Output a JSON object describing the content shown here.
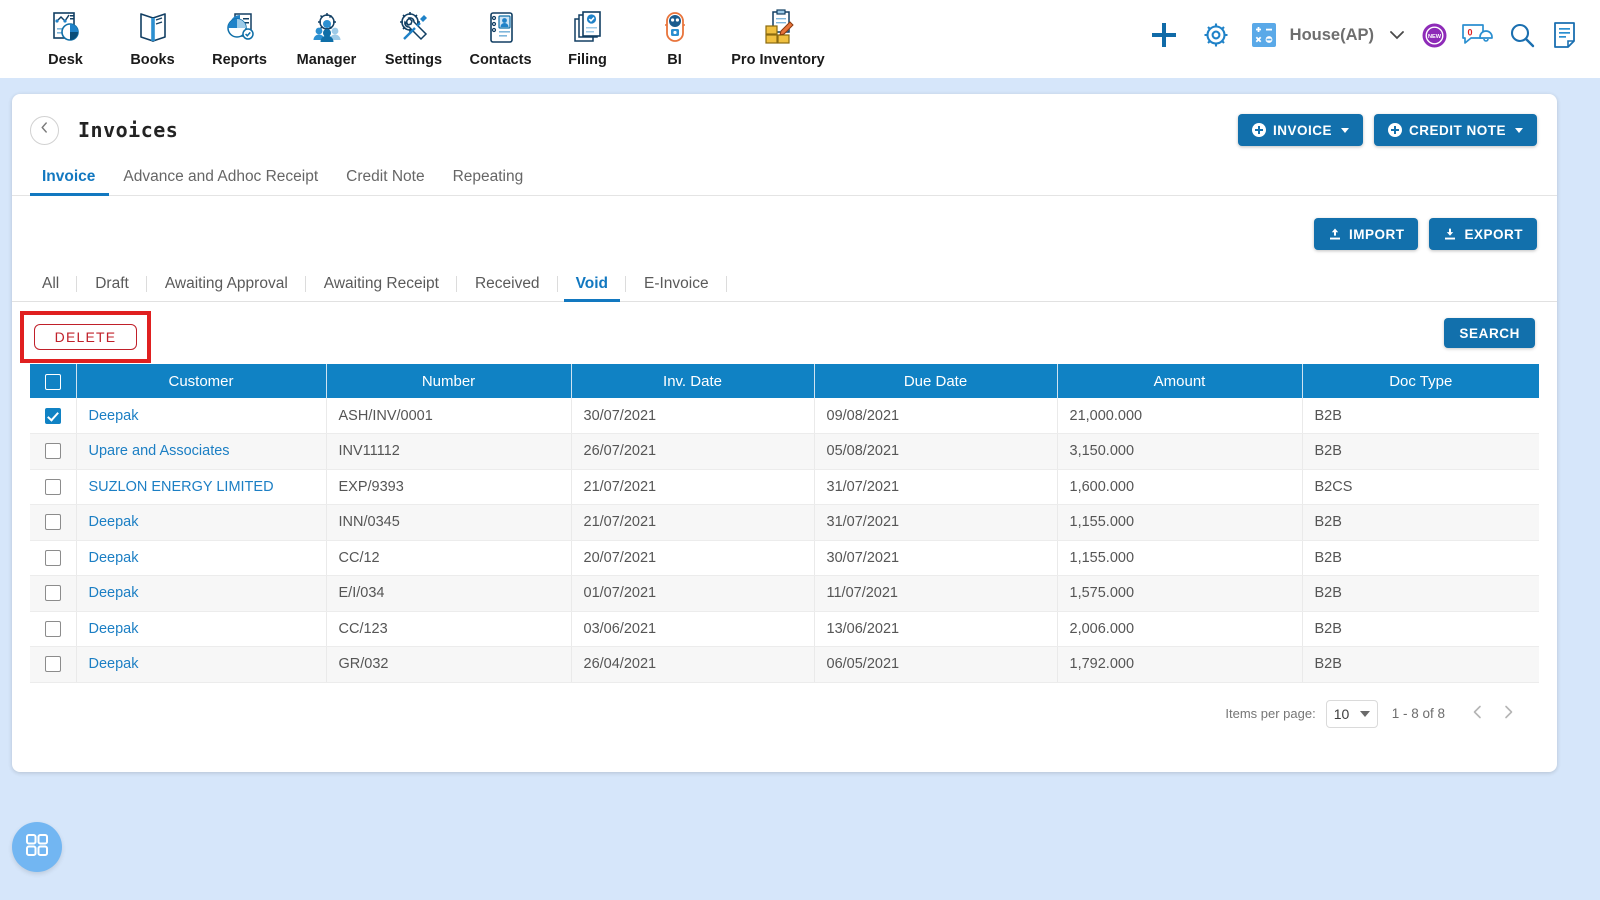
{
  "topnav": {
    "items": [
      {
        "label": "Desk",
        "icon": "dashboard-icon"
      },
      {
        "label": "Books",
        "icon": "book-icon"
      },
      {
        "label": "Reports",
        "icon": "reports-chart-icon"
      },
      {
        "label": "Manager",
        "icon": "manager-gear-people-icon"
      },
      {
        "label": "Settings",
        "icon": "settings-tools-icon"
      },
      {
        "label": "Contacts",
        "icon": "contacts-card-icon"
      },
      {
        "label": "Filing",
        "icon": "filing-documents-icon"
      },
      {
        "label": "BI",
        "icon": "bi-robot-icon"
      },
      {
        "label": "Pro Inventory",
        "icon": "pro-inventory-boxes-icon"
      }
    ],
    "right": {
      "add_icon": "plus-icon",
      "settings_icon": "gear-icon",
      "calculator_icon": "calculator-icon",
      "org_name": "House(AP)",
      "org_caret_icon": "chevron-down-icon",
      "new_badge_icon": "new-badge-icon",
      "new_badge_text": "NEW",
      "notifications_icon": "chat-bell-icon",
      "notifications_count": "0",
      "search_icon": "search-icon",
      "notes_icon": "notepad-icon"
    }
  },
  "page": {
    "back_icon": "chevron-left-icon",
    "title": "Invoices",
    "primary_actions": [
      {
        "label": "INVOICE",
        "icon": "plus-circle-icon",
        "caret": "caret-down-icon"
      },
      {
        "label": "CREDIT NOTE",
        "icon": "plus-circle-icon",
        "caret": "caret-down-icon"
      }
    ],
    "tabs": [
      {
        "label": "Invoice",
        "active": true
      },
      {
        "label": "Advance and Adhoc Receipt",
        "active": false
      },
      {
        "label": "Credit Note",
        "active": false
      },
      {
        "label": "Repeating",
        "active": false
      }
    ],
    "io_buttons": [
      {
        "label": "IMPORT",
        "icon": "upload-icon"
      },
      {
        "label": "EXPORT",
        "icon": "download-icon"
      }
    ],
    "status_filters": [
      {
        "label": "All",
        "active": false
      },
      {
        "label": "Draft",
        "active": false
      },
      {
        "label": "Awaiting Approval",
        "active": false
      },
      {
        "label": "Awaiting Receipt",
        "active": false
      },
      {
        "label": "Received",
        "active": false
      },
      {
        "label": "Void",
        "active": true
      },
      {
        "label": "E-Invoice",
        "active": false
      }
    ],
    "delete_label": "DELETE",
    "search_label": "SEARCH",
    "highlight_color": "#e02020",
    "accent_color": "#1082c4"
  },
  "table": {
    "columns": [
      "",
      "Customer",
      "Number",
      "Inv. Date",
      "Due Date",
      "Amount",
      "Doc Type"
    ],
    "header_select_all_checked": false,
    "rows": [
      {
        "selected": true,
        "customer": "Deepak",
        "number": "ASH/INV/0001",
        "inv_date": "30/07/2021",
        "due_date": "09/08/2021",
        "amount": "21,000.000",
        "doc_type": "B2B"
      },
      {
        "selected": false,
        "customer": "Upare and Associates",
        "number": "INV11112",
        "inv_date": "26/07/2021",
        "due_date": "05/08/2021",
        "amount": "3,150.000",
        "doc_type": "B2B"
      },
      {
        "selected": false,
        "customer": "SUZLON ENERGY LIMITED",
        "number": "EXP/9393",
        "inv_date": "21/07/2021",
        "due_date": "31/07/2021",
        "amount": "1,600.000",
        "doc_type": "B2CS"
      },
      {
        "selected": false,
        "customer": "Deepak",
        "number": "INN/0345",
        "inv_date": "21/07/2021",
        "due_date": "31/07/2021",
        "amount": "1,155.000",
        "doc_type": "B2B"
      },
      {
        "selected": false,
        "customer": "Deepak",
        "number": "CC/12",
        "inv_date": "20/07/2021",
        "due_date": "30/07/2021",
        "amount": "1,155.000",
        "doc_type": "B2B"
      },
      {
        "selected": false,
        "customer": "Deepak",
        "number": "E/I/034",
        "inv_date": "01/07/2021",
        "due_date": "11/07/2021",
        "amount": "1,575.000",
        "doc_type": "B2B"
      },
      {
        "selected": false,
        "customer": "Deepak",
        "number": "CC/123",
        "inv_date": "03/06/2021",
        "due_date": "13/06/2021",
        "amount": "2,006.000",
        "doc_type": "B2B"
      },
      {
        "selected": false,
        "customer": "Deepak",
        "number": "GR/032",
        "inv_date": "26/04/2021",
        "due_date": "06/05/2021",
        "amount": "1,792.000",
        "doc_type": "B2B"
      }
    ]
  },
  "paginator": {
    "items_per_page_label": "Items per page:",
    "items_per_page_value": "10",
    "range_label": "1 - 8 of 8",
    "prev_icon": "chevron-left-icon",
    "next_icon": "chevron-right-icon"
  },
  "fab": {
    "icon": "grid-apps-icon"
  }
}
